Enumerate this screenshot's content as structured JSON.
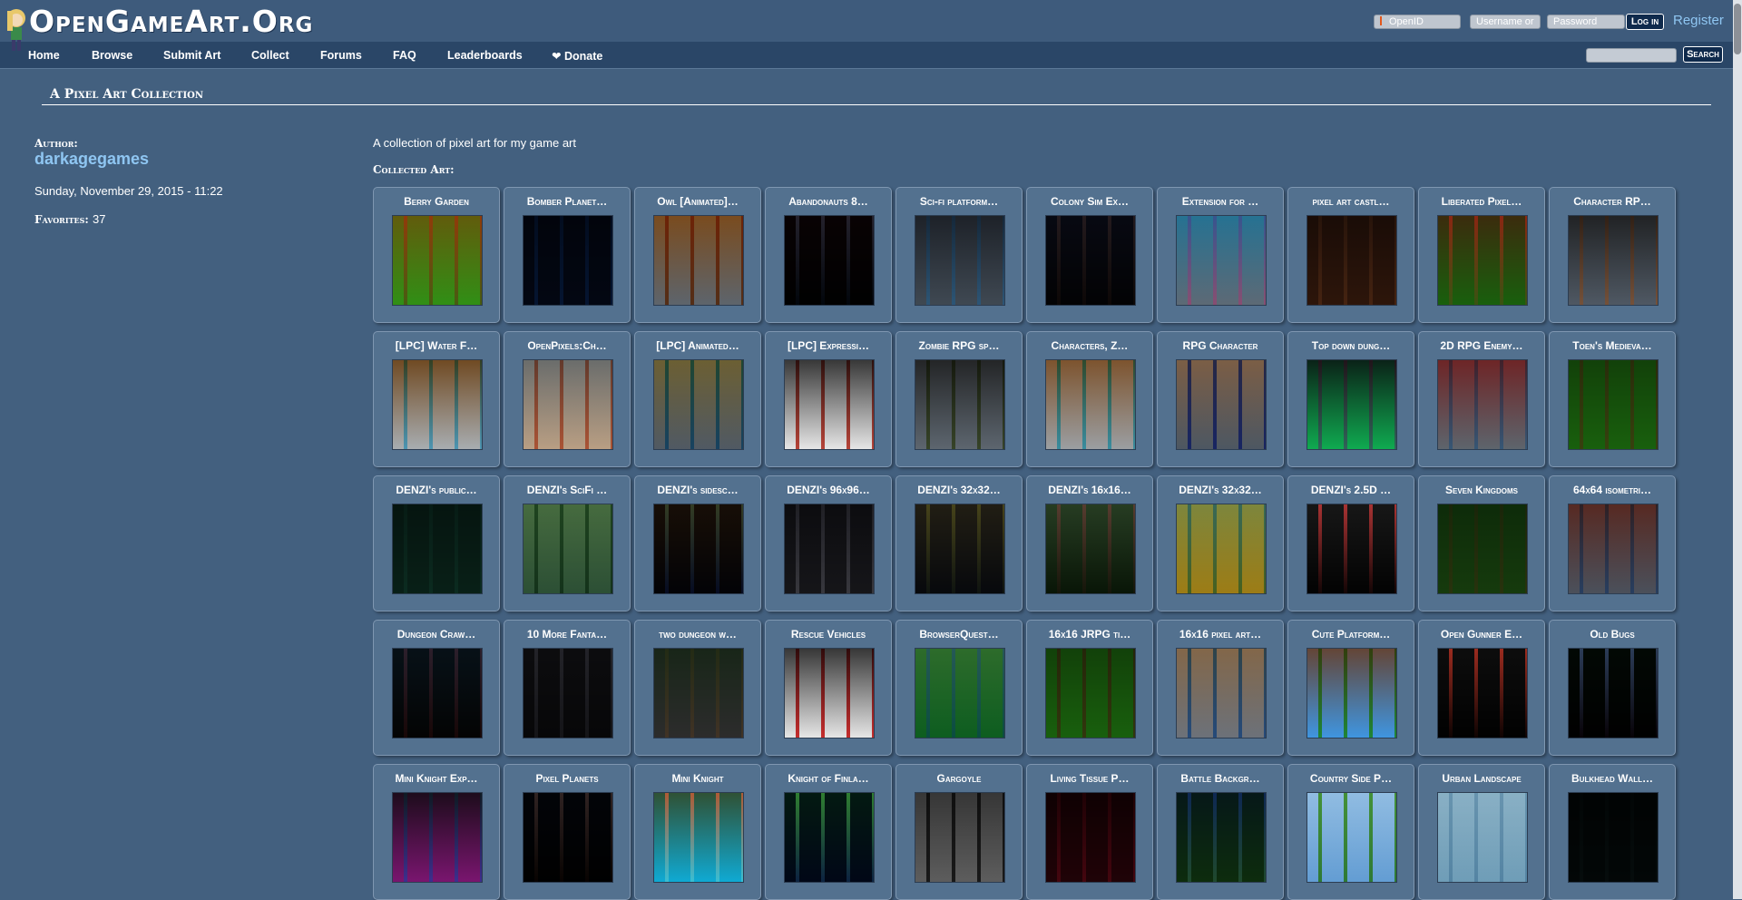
{
  "site": {
    "logo": "OpenGameArt.Org",
    "login": {
      "openid_placeholder": "OpenID",
      "username_placeholder": "Username or",
      "password_placeholder": "Password",
      "login_label": "Log in",
      "register_label": "Register"
    },
    "nav": [
      "Home",
      "Browse",
      "Submit Art",
      "Collect",
      "Forums",
      "FAQ",
      "Leaderboards",
      "❤ Donate"
    ],
    "search_label": "Search"
  },
  "page": {
    "title": "A Pixel Art Collection",
    "author_label": "Author:",
    "author": "darkagegames",
    "date": "Sunday, November 29, 2015 - 11:22",
    "favorites_label": "Favorites:",
    "favorites": "37",
    "description": "A collection of pixel art for my game art",
    "collected_label": "Collected Art:"
  },
  "items": [
    {
      "title": "Berry Garden",
      "colors": [
        "#6fbf4a",
        "#a47a3c",
        "#e07a2a"
      ]
    },
    {
      "title": "Bomber Planet…",
      "colors": [
        "#1b2a44",
        "#2f7db8",
        "#0e1a2b"
      ]
    },
    {
      "title": "Owl [Animated]…",
      "colors": [
        "#9aa0a6",
        "#8a4a24",
        "#c9782f"
      ]
    },
    {
      "title": "Abandonauts 8…",
      "colors": [
        "#0b0b10",
        "#2f8fbf",
        "#c23b3b"
      ]
    },
    {
      "title": "Sci-fi platform…",
      "colors": [
        "#7f8891",
        "#5aa0cf",
        "#3b3f47"
      ]
    },
    {
      "title": "Colony Sim Ex…",
      "colors": [
        "#1a1a20",
        "#7a4b35",
        "#4a5a8f"
      ]
    },
    {
      "title": "Extension for …",
      "colors": [
        "#9aa4ad",
        "#e07aa8",
        "#3fb1d7"
      ]
    },
    {
      "title": "pixel art castl…",
      "colors": [
        "#6b4a34",
        "#a57a55",
        "#3d2a20"
      ]
    },
    {
      "title": "Liberated Pixel…",
      "colors": [
        "#4f9c3a",
        "#b7884e",
        "#c0473b"
      ]
    },
    {
      "title": "Character RP…",
      "colors": [
        "#8e969f",
        "#d18a5d",
        "#3b3b3b"
      ]
    },
    {
      "title": "[LPC] Water F…",
      "colors": [
        "#cfd2d4",
        "#5fb5d6",
        "#8a5a2a"
      ]
    },
    {
      "title": "OpenPixels:Ch…",
      "colors": [
        "#d9c9b7",
        "#c86a4a",
        "#7d8a96"
      ]
    },
    {
      "title": "[LPC] Animated…",
      "colors": [
        "#8f979f",
        "#2a6f9a",
        "#c0a052"
      ]
    },
    {
      "title": "[LPC] Expressi…",
      "colors": [
        "#f2f2f2",
        "#c0473b",
        "#3b3b3b"
      ]
    },
    {
      "title": "Zombie RPG sp…",
      "colors": [
        "#9aa1a8",
        "#5a6b3d",
        "#3b3b3b"
      ]
    },
    {
      "title": "Characters, Z…",
      "colors": [
        "#c7c9cb",
        "#4ab2c7",
        "#a06a3a"
      ]
    },
    {
      "title": "RPG Character",
      "colors": [
        "#8c959e",
        "#2b3f9e",
        "#e0a070"
      ]
    },
    {
      "title": "Top down dung…",
      "colors": [
        "#3fd08f",
        "#c27a9f",
        "#2a2a2a"
      ]
    },
    {
      "title": "2D RPG Enemy…",
      "colors": [
        "#9aa0a6",
        "#5a8ab4",
        "#b53b3b"
      ]
    },
    {
      "title": "Toen's Medieva…",
      "colors": [
        "#4f9c3a",
        "#b26a3f",
        "#3a6a2a"
      ]
    },
    {
      "title": "DENZI's public…",
      "colors": [
        "#2f5a4d",
        "#3f7a6a",
        "#1c3a33"
      ]
    },
    {
      "title": "DENZI's SciFi …",
      "colors": [
        "#6a8e74",
        "#2f5a3a",
        "#a8c08a"
      ]
    },
    {
      "title": "DENZI's sidesc…",
      "colors": [
        "#1a1a28",
        "#3a6fd8",
        "#e08a2a"
      ]
    },
    {
      "title": "DENZI's 96x96…",
      "colors": [
        "#4a4a50",
        "#bfbfc4",
        "#2a2a30"
      ]
    },
    {
      "title": "DENZI's 32x32…",
      "colors": [
        "#2a2f38",
        "#5a6b4a",
        "#c7a05a"
      ]
    },
    {
      "title": "DENZI's 16x16…",
      "colors": [
        "#2f4a2a",
        "#6b4a3a",
        "#cfcfcf"
      ]
    },
    {
      "title": "DENZI's 32x32…",
      "colors": [
        "#c8b24a",
        "#5a8a6a",
        "#9fc0d0"
      ]
    },
    {
      "title": "DENZI's 2.5D …",
      "colors": [
        "#1a1a1a",
        "#c03a3a",
        "#dfdfdf"
      ]
    },
    {
      "title": "Seven Kingdoms",
      "colors": [
        "#4a7a3a",
        "#8a6a3a",
        "#2f5a2a"
      ]
    },
    {
      "title": "64x64 isometri…",
      "colors": [
        "#8a8f98",
        "#4a6fa0",
        "#a04a3a"
      ]
    },
    {
      "title": "Dungeon Craw…",
      "colors": [
        "#1f1f1f",
        "#c03a3a",
        "#3a8ac0"
      ]
    },
    {
      "title": "10 More Fanta…",
      "colors": [
        "#2a2a2e",
        "#7a7a82",
        "#4a4a50"
      ]
    },
    {
      "title": "two dungeon w…",
      "colors": [
        "#6a6a6a",
        "#9a7a5a",
        "#3a5a3a"
      ]
    },
    {
      "title": "Rescue Vehicles",
      "colors": [
        "#f2f2f2",
        "#d03030",
        "#3a3a3a"
      ]
    },
    {
      "title": "BrowserQuest…",
      "colors": [
        "#3a9a5a",
        "#2f7fb5",
        "#c8b27a"
      ]
    },
    {
      "title": "16x16 JRPG ti…",
      "colors": [
        "#4f9c3a",
        "#a0593a",
        "#3a6a2a"
      ]
    },
    {
      "title": "16x16 pixel art…",
      "colors": [
        "#a6aab0",
        "#3a6fb0",
        "#c89a6a"
      ]
    },
    {
      "title": "Cute Platform…",
      "colors": [
        "#7fc3ef",
        "#3fae3a",
        "#c85a3a"
      ]
    },
    {
      "title": "Open Gunner E…",
      "colors": [
        "#111111",
        "#d03a2a",
        "#bfbfbf"
      ]
    },
    {
      "title": "Old Bugs",
      "colors": [
        "#0a0a0a",
        "#c04ac8",
        "#3ad070"
      ]
    },
    {
      "title": "Mini Knight Exp…",
      "colors": [
        "#b04aa8",
        "#5aa0d8",
        "#2a2a2a"
      ]
    },
    {
      "title": "Pixel Planets",
      "colors": [
        "#0a0a0a",
        "#d0542a",
        "#3a6ad0"
      ]
    },
    {
      "title": "Mini Knight",
      "colors": [
        "#3fd0e8",
        "#e8e8e8",
        "#c0643a"
      ]
    },
    {
      "title": "Knight of Finla…",
      "colors": [
        "#0f2a4c",
        "#d0d0d8",
        "#3a9a3a"
      ]
    },
    {
      "title": "Gargoyle",
      "colors": [
        "#9a9a9a",
        "#2a2a2a",
        "#5a5a5a"
      ]
    },
    {
      "title": "Living Tissue P…",
      "colors": [
        "#5a1a2a",
        "#c03a5a",
        "#2a0a10"
      ]
    },
    {
      "title": "Battle Backgr…",
      "colors": [
        "#3a6a3a",
        "#8ab0c8",
        "#1a3a6a"
      ]
    },
    {
      "title": "Country Side P…",
      "colors": [
        "#9fc8e8",
        "#4a9a3a",
        "#e8f0f8"
      ]
    },
    {
      "title": "Urban Landscape",
      "colors": [
        "#a8c8d8",
        "#7fa8c0",
        "#d0e0e8"
      ]
    },
    {
      "title": "Bulkhead Wall…",
      "colors": [
        "#1a2a2a",
        "#3a4a4a",
        "#0a1515"
      ]
    }
  ]
}
